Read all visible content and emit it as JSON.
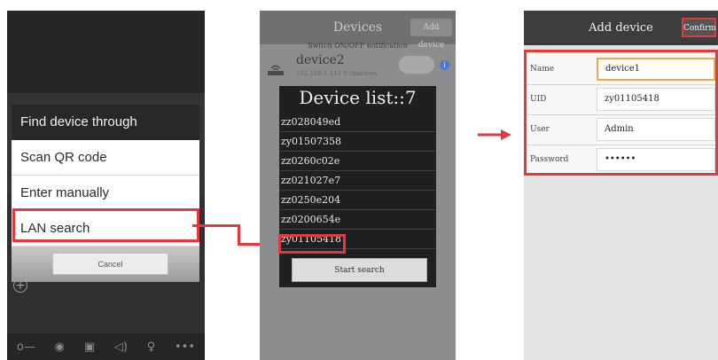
{
  "screen1": {
    "dialog_title": "Find device through",
    "options": [
      "Scan QR code",
      "Enter manually",
      "LAN search"
    ],
    "cancel_label": "Cancel",
    "add_symbol": "+",
    "bottom_icons": [
      "key-icon",
      "camera-icon",
      "photos-icon",
      "speaker-icon",
      "microphone-icon",
      "more-icon"
    ],
    "bottom_glyphs": [
      "o—",
      "◉",
      "▣",
      "◁)",
      "♀",
      "•••"
    ]
  },
  "screen2": {
    "nav_title": "Devices",
    "add_button": "Add device",
    "notification": "Switch ON/OFF notification",
    "device_name": "device2",
    "device_info": "192.168.1.111 0 channels",
    "info_symbol": "i",
    "list_title": "Device list::7",
    "devices": [
      "zz028049ed",
      "zy01507358",
      "zz0260c02e",
      "zz021027e7",
      "zz0250e204",
      "zz0200654e",
      "zy01105418"
    ],
    "start_button": "Start search"
  },
  "screen3": {
    "nav_title": "Add device",
    "confirm_label": "Confirm",
    "fields": [
      {
        "label": "Name",
        "value": "device1"
      },
      {
        "label": "UID",
        "value": "zy01105418"
      },
      {
        "label": "User",
        "value": "Admin"
      },
      {
        "label": "Password",
        "value": "••••••"
      }
    ]
  },
  "colors": {
    "highlight": "#e03a3a",
    "focus": "#f0a848"
  }
}
